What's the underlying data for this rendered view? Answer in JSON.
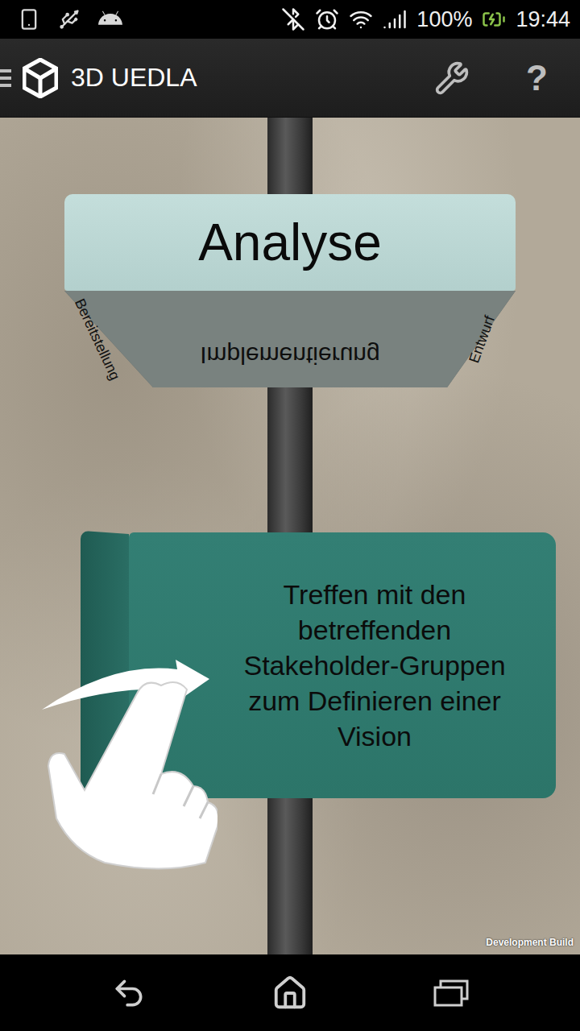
{
  "status_bar": {
    "battery": "100%",
    "time": "19:44",
    "charging": true
  },
  "app_bar": {
    "title": "3D UEDLA",
    "help": "?"
  },
  "top_sign": {
    "front": "Analyse",
    "bottom": "Implementierung",
    "left": "Bereitstellung",
    "right": "Entwurf"
  },
  "bottom_sign": {
    "text": "Treffen mit den betreffenden Stakeholder-Gruppen zum Definieren einer Vision"
  },
  "watermark": "Development Build"
}
